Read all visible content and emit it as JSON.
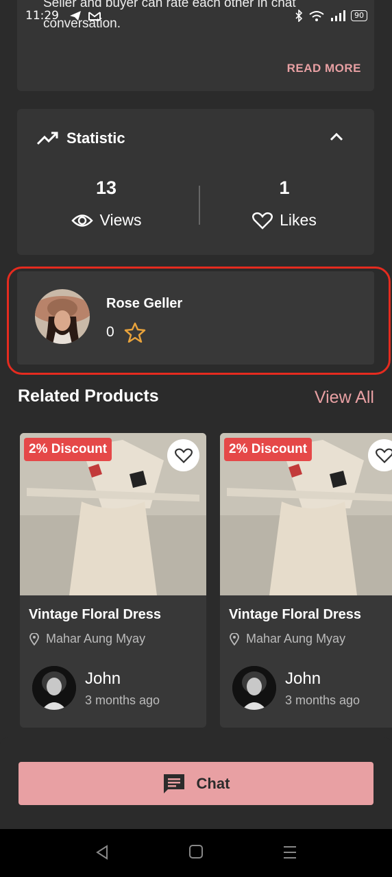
{
  "status_bar": {
    "time": "11:29",
    "battery": "90"
  },
  "description": {
    "text": "Seller and buyer can rate each other in chat conversation.",
    "read_more": "READ MORE"
  },
  "statistic": {
    "title": "Statistic",
    "views_count": "13",
    "views_label": "Views",
    "likes_count": "1",
    "likes_label": "Likes"
  },
  "seller": {
    "name": "Rose Geller",
    "rating": "0"
  },
  "related": {
    "title": "Related Products",
    "view_all": "View All",
    "products": [
      {
        "discount": "2% Discount",
        "name": "Vintage Floral Dress",
        "location": "Mahar Aung Myay",
        "user": "John",
        "time": "3 months ago"
      },
      {
        "discount": "2% Discount",
        "name": "Vintage Floral Dress",
        "location": "Mahar Aung Myay",
        "user": "John",
        "time": "3 months ago"
      }
    ]
  },
  "chat": {
    "label": "Chat"
  },
  "colors": {
    "accent": "#e8a0a3",
    "discount": "#e54848",
    "highlight": "#e52b1f",
    "star": "#e8a33c"
  }
}
